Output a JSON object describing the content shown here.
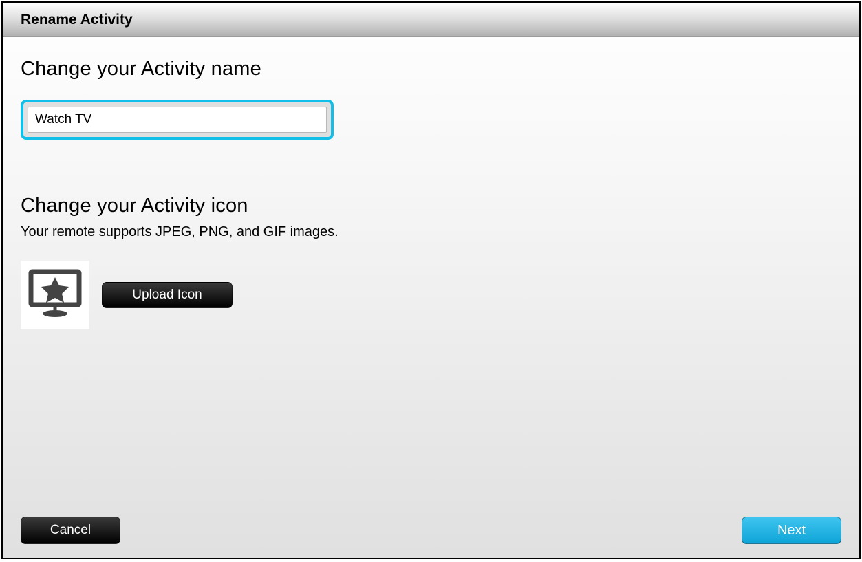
{
  "header": {
    "title": "Rename Activity"
  },
  "name_section": {
    "heading": "Change your Activity name",
    "input_value": "Watch TV"
  },
  "icon_section": {
    "heading": "Change your Activity icon",
    "subtext": "Your remote supports JPEG, PNG, and GIF images.",
    "upload_label": "Upload Icon"
  },
  "footer": {
    "cancel_label": "Cancel",
    "next_label": "Next"
  }
}
